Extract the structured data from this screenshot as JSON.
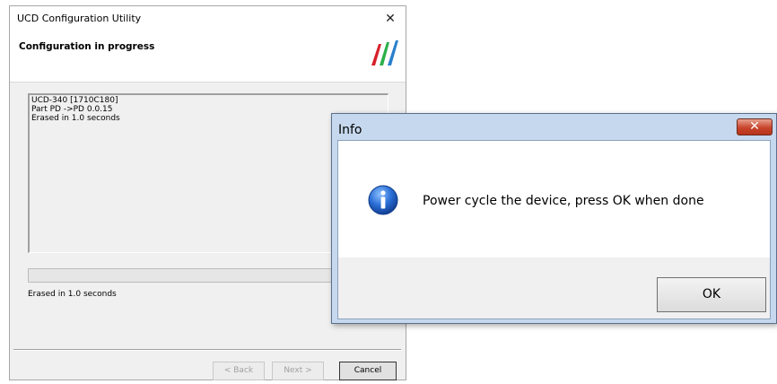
{
  "wizard": {
    "title": "UCD Configuration Utility",
    "close_glyph": "✕",
    "heading": "Configuration in progress",
    "log_lines": [
      "UCD-340 [1710C180]",
      "Part PD ->PD 0.0.15",
      "Erased in 1.0 seconds"
    ],
    "progress_fraction": 0,
    "status": "Erased in 1.0 seconds",
    "buttons": {
      "back": "< Back",
      "next": "Next >",
      "cancel": "Cancel"
    },
    "logo_colors": [
      "#d7212a",
      "#2bb04a",
      "#2a7fcc"
    ]
  },
  "dialog": {
    "title": "Info",
    "close_glyph": "✕",
    "message": "Power cycle the device, press OK when done",
    "ok_label": "OK",
    "icon": "info-icon"
  }
}
